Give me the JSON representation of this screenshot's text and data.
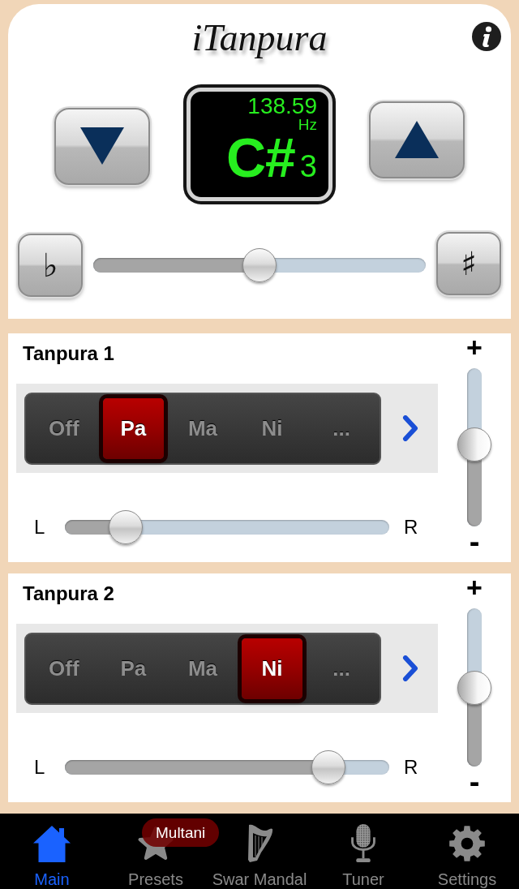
{
  "header": {
    "title": "iTanpura"
  },
  "pitch": {
    "frequency": "138.59",
    "unit": "Hz",
    "note": "C#",
    "octave": "3"
  },
  "fine_tune": {
    "flat_button": "♭",
    "sharp_button": "♯",
    "level": 0.5
  },
  "tanpuras": [
    {
      "title": "Tanpura 1",
      "strings": [
        {
          "label": "Off",
          "selected": false
        },
        {
          "label": "Pa",
          "selected": true
        },
        {
          "label": "Ma",
          "selected": false
        },
        {
          "label": "Ni",
          "selected": false
        },
        {
          "label": "...",
          "selected": false
        }
      ],
      "pan": {
        "left_label": "L",
        "right_label": "R",
        "level": 0.15
      },
      "volume": {
        "plus_label": "+",
        "minus_label": "-",
        "level": 0.52
      }
    },
    {
      "title": "Tanpura 2",
      "strings": [
        {
          "label": "Off",
          "selected": false
        },
        {
          "label": "Pa",
          "selected": false
        },
        {
          "label": "Ma",
          "selected": false
        },
        {
          "label": "Ni",
          "selected": true
        },
        {
          "label": "...",
          "selected": false
        }
      ],
      "pan": {
        "left_label": "L",
        "right_label": "R",
        "level": 0.85
      },
      "volume": {
        "plus_label": "+",
        "minus_label": "-",
        "level": 0.5
      }
    }
  ],
  "tab_bar": {
    "tabs": [
      {
        "label": "Main",
        "selected": true
      },
      {
        "label": "Presets",
        "selected": false,
        "badge": "Multani"
      },
      {
        "label": "Swar Mandal",
        "selected": false
      },
      {
        "label": "Tuner",
        "selected": false
      },
      {
        "label": "Settings",
        "selected": false
      }
    ]
  }
}
